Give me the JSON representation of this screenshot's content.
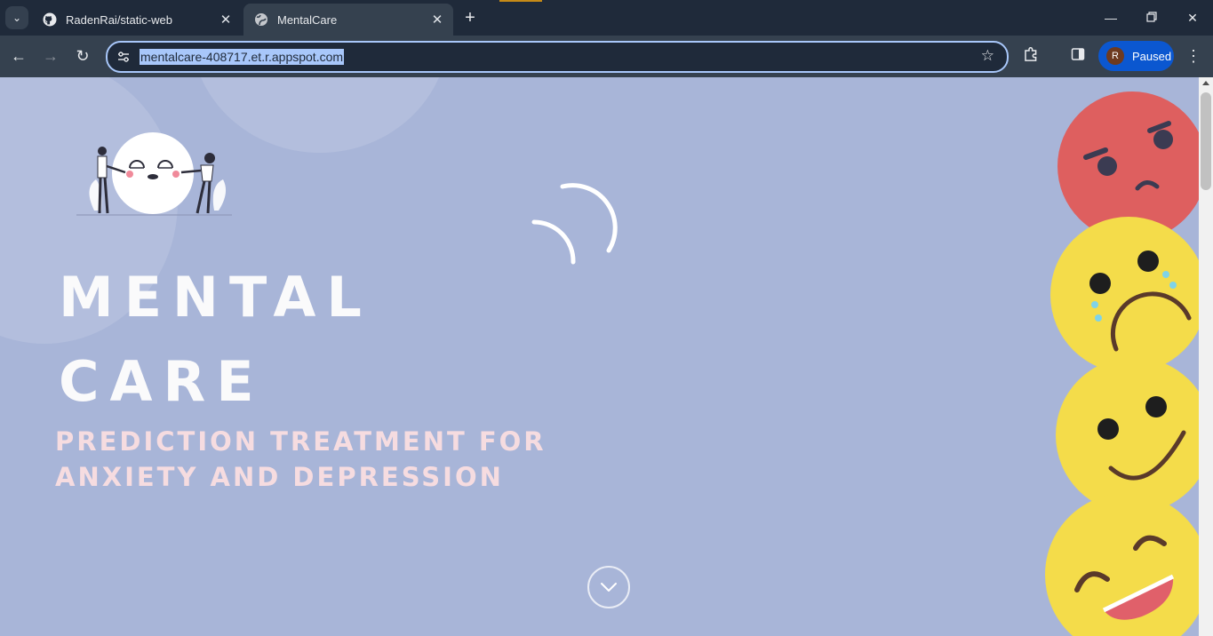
{
  "browser": {
    "tabs": [
      {
        "title": "RadenRai/static-web",
        "icon": "github-icon",
        "active": false
      },
      {
        "title": "MentalCare",
        "icon": "globe-icon",
        "active": true
      }
    ],
    "address": "mentalcare-408717.et.r.appspot.com",
    "profile": {
      "initial": "R",
      "status": "Paused"
    }
  },
  "hero": {
    "title_line1": "MENTAL",
    "title_line2": "CARE",
    "subtitle_line1": "PREDICTION TREATMENT FOR",
    "subtitle_line2": "ANXIETY AND DEPRESSION"
  },
  "colors": {
    "page_bg": "#a8b5d8",
    "title": "#fafafb",
    "subtitle": "#f6dce0",
    "emoji_angry": "#de5f5f",
    "emoji_yellow": "#f4dc4a"
  }
}
